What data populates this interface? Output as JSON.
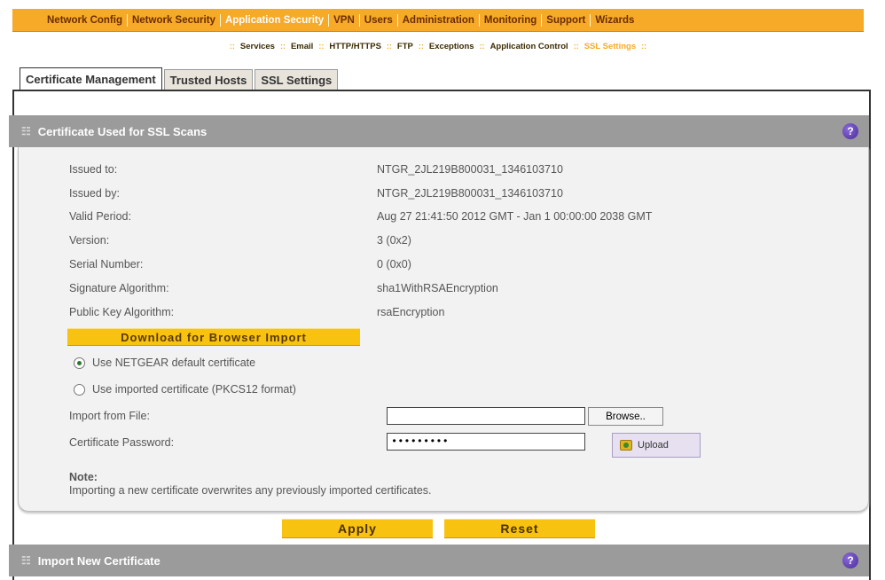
{
  "topnav": {
    "items": [
      {
        "label": "Network Config"
      },
      {
        "label": "Network Security"
      },
      {
        "label": "Application Security"
      },
      {
        "label": "VPN"
      },
      {
        "label": "Users"
      },
      {
        "label": "Administration"
      },
      {
        "label": "Monitoring"
      },
      {
        "label": "Support"
      },
      {
        "label": "Wizards"
      }
    ],
    "active_index": 2
  },
  "subnav": {
    "items": [
      {
        "label": "Services"
      },
      {
        "label": "Email"
      },
      {
        "label": "HTTP/HTTPS"
      },
      {
        "label": "FTP"
      },
      {
        "label": "Exceptions"
      },
      {
        "label": "Application Control"
      },
      {
        "label": "SSL Settings"
      }
    ],
    "separator": "::"
  },
  "tabs": [
    {
      "label": "Certificate Management"
    },
    {
      "label": "Trusted Hosts"
    },
    {
      "label": "SSL Settings"
    }
  ],
  "section1": {
    "title": "Certificate Used for SSL Scans",
    "help": "?",
    "grip": "☷"
  },
  "certificate": {
    "issued_to": {
      "label": "Issued to:",
      "value": "NTGR_2JL219B800031_1346103710"
    },
    "issued_by": {
      "label": "Issued by:",
      "value": "NTGR_2JL219B800031_1346103710"
    },
    "valid_period": {
      "label": "Valid Period:",
      "value": "Aug 27 21:41:50 2012 GMT - Jan 1 00:00:00 2038 GMT"
    },
    "version": {
      "label": "Version:",
      "value": "3 (0x2)"
    },
    "serial": {
      "label": "Serial Number:",
      "value": "0 (0x0)"
    },
    "sig_alg": {
      "label": "Signature Algorithm:",
      "value": "sha1WithRSAEncryption"
    },
    "pubkey_alg": {
      "label": "Public Key Algorithm:",
      "value": "rsaEncryption"
    }
  },
  "download_button": "Download for Browser Import",
  "radio_default": "Use NETGEAR default certificate",
  "radio_imported": "Use imported certificate (PKCS12 format)",
  "import_file": {
    "label": "Import from File:",
    "value": ""
  },
  "browse_button": "Browse..",
  "cert_password": {
    "label": "Certificate Password:",
    "value": "•••••••••"
  },
  "upload_button": "Upload",
  "note": {
    "title": "Note:",
    "text": "Importing a new certificate overwrites any previously imported certificates."
  },
  "apply_button": "Apply",
  "reset_button": "Reset",
  "section2": {
    "title": "Import New Certificate",
    "help": "?",
    "grip": "☷"
  },
  "colors": {
    "nav_orange": "#f7a928",
    "button_yellow": "#f7c210",
    "section_gray": "#9b9b9b",
    "help_purple": "#5b3aa8"
  }
}
